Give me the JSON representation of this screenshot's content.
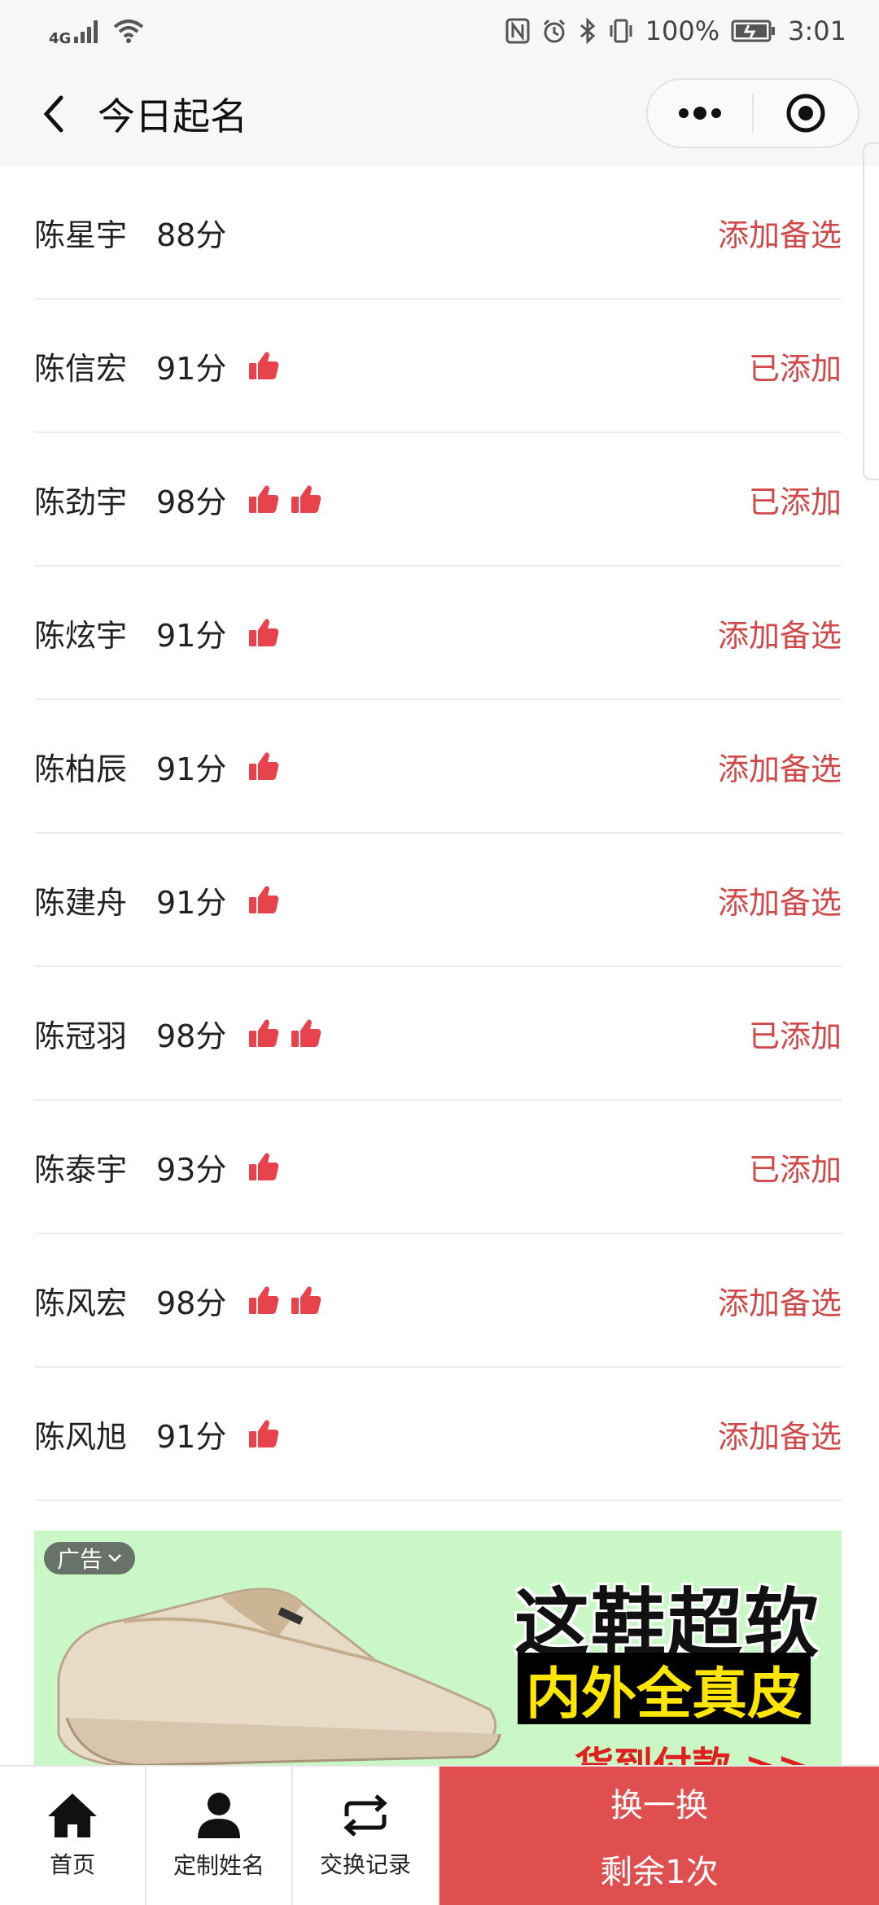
{
  "status_bar": {
    "network": "4G",
    "battery": "100%",
    "time": "3:01"
  },
  "nav": {
    "title": "今日起名"
  },
  "colors": {
    "accent": "#d04848",
    "thumb": "#e8424d",
    "swap_bg": "#e04f4f",
    "ad_bg": "#c9f7c5"
  },
  "names": [
    {
      "name": "陈星宇",
      "score": "88分",
      "thumbs": 0,
      "action": "添加备选"
    },
    {
      "name": "陈信宏",
      "score": "91分",
      "thumbs": 1,
      "action": "已添加"
    },
    {
      "name": "陈劲宇",
      "score": "98分",
      "thumbs": 2,
      "action": "已添加"
    },
    {
      "name": "陈炫宇",
      "score": "91分",
      "thumbs": 1,
      "action": "添加备选"
    },
    {
      "name": "陈柏辰",
      "score": "91分",
      "thumbs": 1,
      "action": "添加备选"
    },
    {
      "name": "陈建舟",
      "score": "91分",
      "thumbs": 1,
      "action": "添加备选"
    },
    {
      "name": "陈冠羽",
      "score": "98分",
      "thumbs": 2,
      "action": "已添加"
    },
    {
      "name": "陈泰宇",
      "score": "93分",
      "thumbs": 1,
      "action": "已添加"
    },
    {
      "name": "陈风宏",
      "score": "98分",
      "thumbs": 2,
      "action": "添加备选"
    },
    {
      "name": "陈风旭",
      "score": "91分",
      "thumbs": 1,
      "action": "添加备选"
    }
  ],
  "ad": {
    "badge": "广告",
    "line1": "这鞋超软",
    "line2": "内外全真皮",
    "line3": "货到付款 >>"
  },
  "tabbar": {
    "home": {
      "label": "首页",
      "icon": "home-icon"
    },
    "custom": {
      "label": "定制姓名",
      "icon": "user-icon"
    },
    "history": {
      "label": "交换记录",
      "icon": "swap-arrows-icon"
    },
    "swap": {
      "label": "换一换",
      "remaining": "剩余1次"
    }
  }
}
